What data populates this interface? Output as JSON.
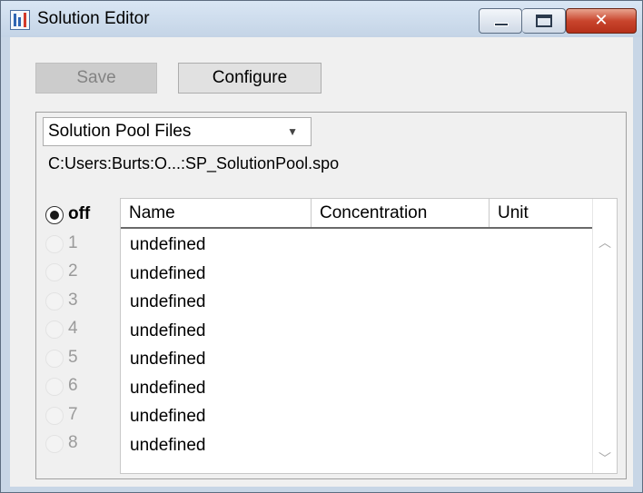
{
  "window": {
    "title": "Solution Editor",
    "controls": {
      "minimize": "minimize-icon",
      "maximize": "maximize-icon",
      "close": "✕"
    }
  },
  "toolbar": {
    "save_label": "Save",
    "save_enabled": false,
    "configure_label": "Configure"
  },
  "source": {
    "selected": "Solution Pool Files",
    "path": "C:Users:Burts:O...:SP_SolutionPool.spo"
  },
  "radios": [
    {
      "label": "off",
      "selected": true
    },
    {
      "label": "1",
      "selected": false
    },
    {
      "label": "2",
      "selected": false
    },
    {
      "label": "3",
      "selected": false
    },
    {
      "label": "4",
      "selected": false
    },
    {
      "label": "5",
      "selected": false
    },
    {
      "label": "6",
      "selected": false
    },
    {
      "label": "7",
      "selected": false
    },
    {
      "label": "8",
      "selected": false
    }
  ],
  "table": {
    "columns": [
      "Name",
      "Concentration",
      "Unit"
    ],
    "rows": [
      {
        "name": "undefined",
        "concentration": "",
        "unit": ""
      },
      {
        "name": "undefined",
        "concentration": "",
        "unit": ""
      },
      {
        "name": "undefined",
        "concentration": "",
        "unit": ""
      },
      {
        "name": "undefined",
        "concentration": "",
        "unit": ""
      },
      {
        "name": "undefined",
        "concentration": "",
        "unit": ""
      },
      {
        "name": "undefined",
        "concentration": "",
        "unit": ""
      },
      {
        "name": "undefined",
        "concentration": "",
        "unit": ""
      },
      {
        "name": "undefined",
        "concentration": "",
        "unit": ""
      }
    ]
  },
  "colors": {
    "close_button": "#c9452d",
    "title_gradient": "#d9e6f4",
    "disabled_text": "#838383"
  }
}
